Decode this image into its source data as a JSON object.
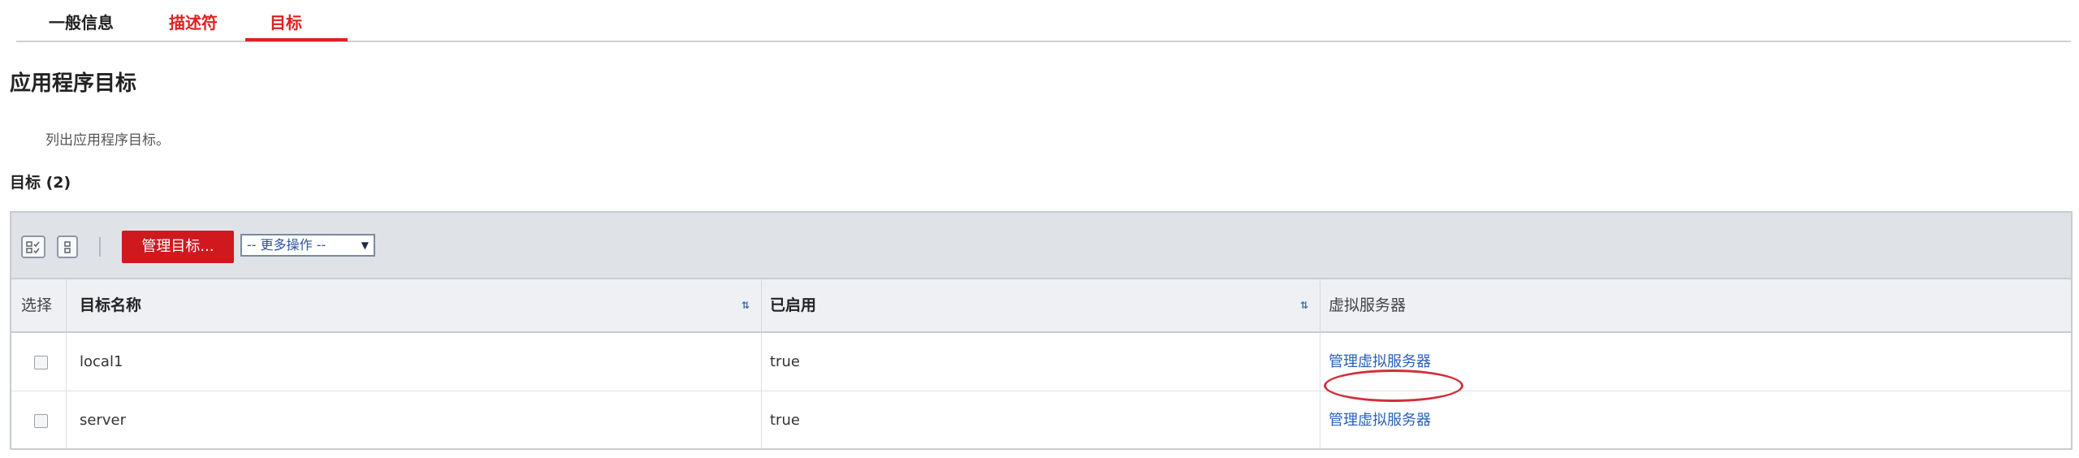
{
  "tabs": [
    "一般信息",
    "描述符",
    "目标"
  ],
  "page": {
    "title": "应用程序目标",
    "description": "列出应用程序目标。",
    "section_title": "目标 (2)"
  },
  "toolbar": {
    "manage_button": "管理目标...",
    "more_actions": "-- 更多操作 --"
  },
  "table": {
    "headers": [
      "选择",
      "目标名称",
      "已启用",
      "虚拟服务器"
    ],
    "rows": [
      {
        "name": "local1",
        "enabled": "true",
        "virtual_servers": "管理虚拟服务器"
      },
      {
        "name": "server",
        "enabled": "true",
        "virtual_servers": "管理虚拟服务器"
      }
    ]
  },
  "colors": {
    "accent": "#e02020",
    "button": "#d0191f",
    "link": "#2a5fb8",
    "highlight": "#d0303a"
  }
}
